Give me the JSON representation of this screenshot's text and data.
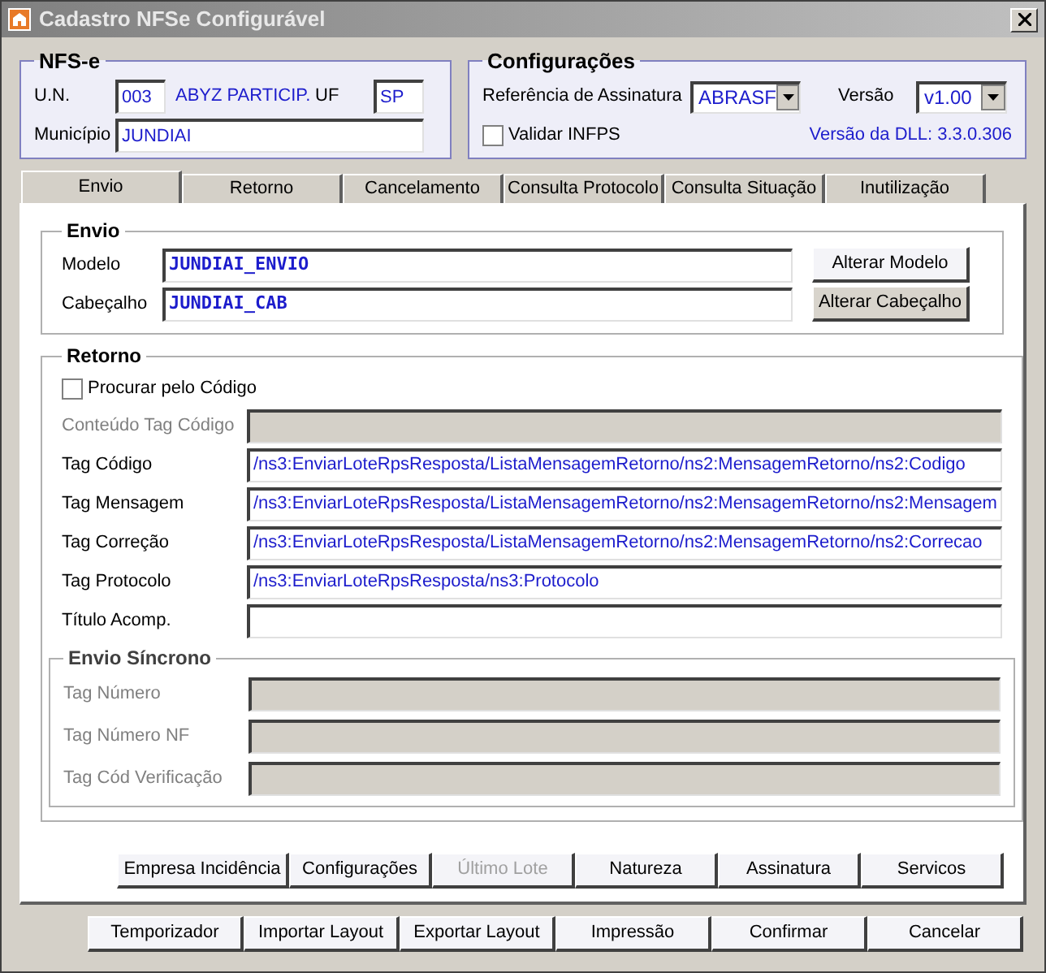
{
  "window": {
    "title": "Cadastro NFSe Configurável"
  },
  "nfse": {
    "title": "NFS-e",
    "un_label": "U.N.",
    "un_value": "003",
    "company": "ABYZ PARTICIP.",
    "uf_label": "UF",
    "uf_value": "SP",
    "municipio_label": "Município",
    "municipio_value": "JUNDIAI"
  },
  "configuracoes": {
    "title": "Configurações",
    "ref_label": "Referência de Assinatura",
    "ref_value": "ABRASF",
    "versao_label": "Versão",
    "versao_value": "v1.00",
    "validar": {
      "label": "Validar INFPS",
      "checked": false
    },
    "dll": "Versão da DLL: 3.3.0.306"
  },
  "tabs": [
    {
      "label": "Envio",
      "selected": true
    },
    {
      "label": "Retorno",
      "selected": false
    },
    {
      "label": "Cancelamento",
      "selected": false
    },
    {
      "label": "Consulta Protocolo",
      "selected": false
    },
    {
      "label": "Consulta Situação",
      "selected": false
    },
    {
      "label": "Inutilização",
      "selected": false
    }
  ],
  "envio": {
    "title": "Envio",
    "rows": [
      {
        "label": "Modelo",
        "value": "JUNDIAI_ENVIO",
        "button": "Alterar Modelo"
      },
      {
        "label": "Cabeçalho",
        "value": "JUNDIAI_CAB",
        "button": "Alterar Cabeçalho"
      }
    ]
  },
  "retorno": {
    "title": "Retorno",
    "procurar": {
      "label": "Procurar pelo Código",
      "checked": false
    },
    "rows": [
      {
        "label": "Conteúdo Tag Código",
        "value": "",
        "disabled": true
      },
      {
        "label": "Tag Código",
        "value": "/ns3:EnviarLoteRpsResposta/ListaMensagemRetorno/ns2:MensagemRetorno/ns2:Codigo",
        "disabled": false
      },
      {
        "label": "Tag Mensagem",
        "value": "/ns3:EnviarLoteRpsResposta/ListaMensagemRetorno/ns2:MensagemRetorno/ns2:Mensagem",
        "disabled": false
      },
      {
        "label": "Tag Correção",
        "value": "/ns3:EnviarLoteRpsResposta/ListaMensagemRetorno/ns2:MensagemRetorno/ns2:Correcao",
        "disabled": false
      },
      {
        "label": "Tag Protocolo",
        "value": "/ns3:EnviarLoteRpsResposta/ns3:Protocolo",
        "disabled": false
      },
      {
        "label": "Título Acomp.",
        "value": "",
        "disabled": false
      }
    ],
    "sincrono": {
      "title": "Envio Síncrono",
      "rows": [
        {
          "label": "Tag Número",
          "disabled": true
        },
        {
          "label": "Tag Número NF",
          "disabled": true
        },
        {
          "label": "Tag Cód Verificação",
          "disabled": true
        }
      ]
    }
  },
  "tab_buttons": [
    {
      "label": "Empresa Incidência",
      "disabled": false
    },
    {
      "label": "Configurações",
      "disabled": false
    },
    {
      "label": "Último Lote",
      "disabled": true
    },
    {
      "label": "Natureza",
      "disabled": false
    },
    {
      "label": "Assinatura",
      "disabled": false
    },
    {
      "label": "Servicos",
      "disabled": false
    }
  ],
  "buttons": [
    "Temporizador",
    "Importar Layout",
    "Exportar Layout",
    "Impressão",
    "Confirmar",
    "Cancelar"
  ]
}
